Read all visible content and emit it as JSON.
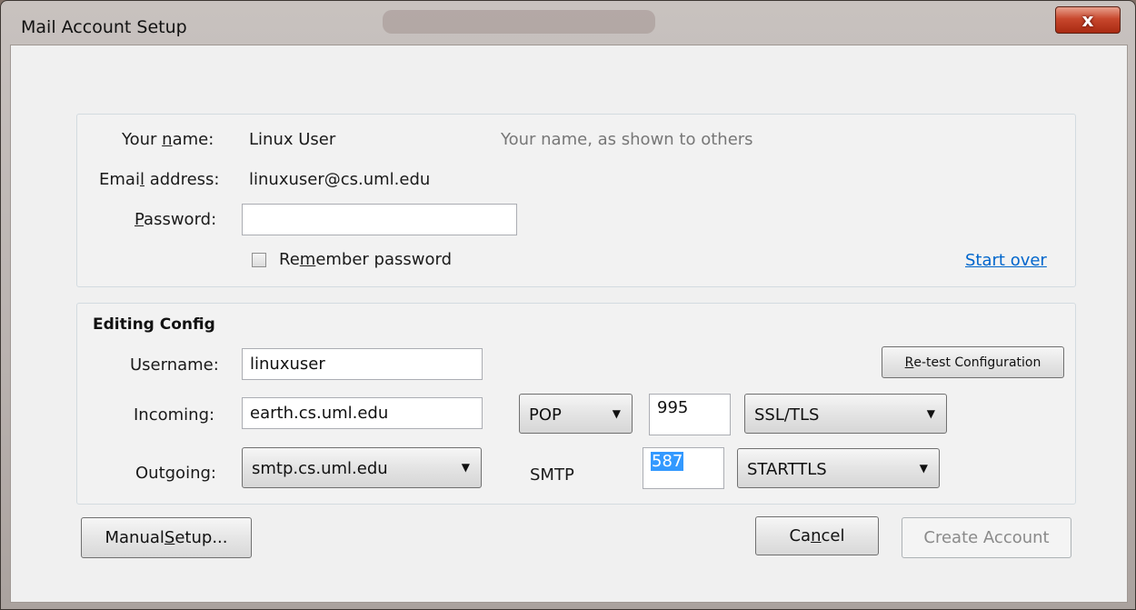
{
  "window": {
    "title": "Mail Account Setup",
    "close_label": "x"
  },
  "identity": {
    "name_label_pre": "Your ",
    "name_label_ul": "n",
    "name_label_post": "ame:",
    "name_value": "Linux User",
    "name_hint": "Your name, as shown to others",
    "email_label_pre": "Emai",
    "email_label_ul": "l",
    "email_label_post": " address:",
    "email_value": "linuxuser@cs.uml.edu",
    "password_label_ul": "P",
    "password_label_post": "assword:",
    "password_value": "",
    "remember_pre": "Re",
    "remember_ul": "m",
    "remember_post": "ember password",
    "remember_checked": false,
    "start_over": "Start over"
  },
  "config": {
    "heading": "Editing Config",
    "username_label": "Username:",
    "username_value": "linuxuser",
    "retest_ul": "R",
    "retest_post": "e-test Configuration",
    "incoming_label": "Incoming:",
    "incoming_server": "earth.cs.uml.edu",
    "incoming_protocol": "POP",
    "incoming_port": "995",
    "incoming_security": "SSL/TLS",
    "outgoing_label": "Outgoing:",
    "outgoing_server": "smtp.cs.uml.edu",
    "outgoing_protocol": "SMTP",
    "outgoing_port": "587",
    "outgoing_security": "STARTTLS"
  },
  "buttons": {
    "manual_pre": "Manual ",
    "manual_ul": "S",
    "manual_post": "etup...",
    "cancel_pre": "Ca",
    "cancel_ul": "n",
    "cancel_post": "cel",
    "create": "Create Account",
    "create_enabled": false
  },
  "icons": {
    "close": "close-icon",
    "dropdown": "chevron-down-icon"
  }
}
